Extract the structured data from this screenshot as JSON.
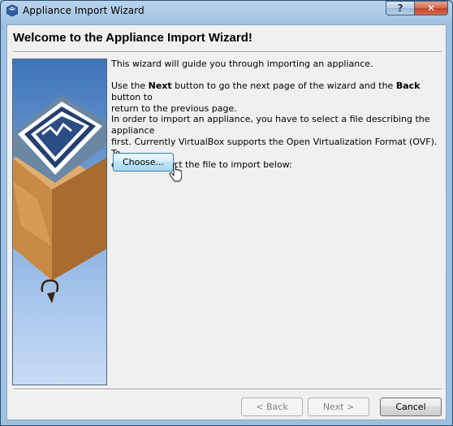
{
  "window": {
    "title": "Appliance Import Wizard",
    "help_label": "?",
    "close_label": "✕"
  },
  "page": {
    "heading": "Welcome to the Appliance Import Wizard!",
    "intro": "This wizard will guide you through importing an appliance.",
    "nav_line1_pre": "Use the ",
    "nav_line1_next": "Next",
    "nav_line1_mid": " button to go the next page of the wizard and the ",
    "nav_line1_back": "Back",
    "nav_line1_post": " button to",
    "nav_line2": "return to the previous page.",
    "import_line1": "In order to import an appliance, you have to select a file describing the appliance",
    "import_line2": "first. Currently VirtualBox supports the Open Virtualization Format (OVF). To",
    "import_line3": "continue, select the file to import below:",
    "choose_label": "Choose..."
  },
  "buttons": {
    "back_label": "< Back",
    "next_label": "Next >",
    "cancel_label": "Cancel"
  }
}
